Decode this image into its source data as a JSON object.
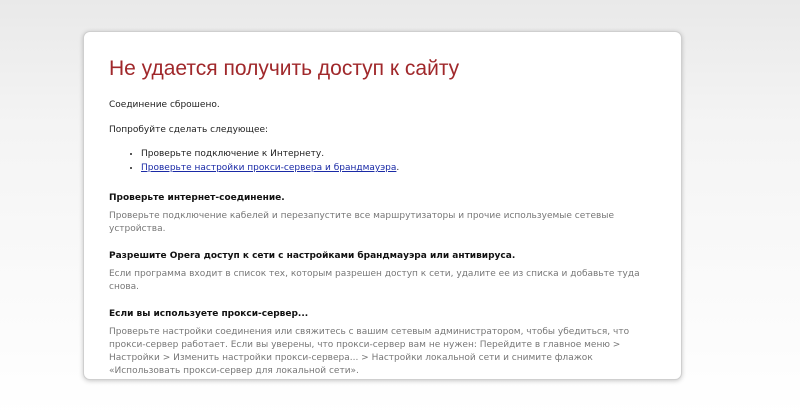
{
  "error": {
    "title": "Не удается получить доступ к сайту",
    "connection_reset": "Соединение сброшено.",
    "try_following": "Попробуйте сделать следующее:",
    "suggestions": [
      {
        "text": "Проверьте подключение к Интернету.",
        "link": false
      },
      {
        "text": "Проверьте настройки прокси-сервера и брандмауэра",
        "link": true,
        "suffix": "."
      }
    ]
  },
  "sections": [
    {
      "title": "Проверьте интернет-соединение.",
      "body": "Проверьте подключение кабелей и перезапустите все маршрутизаторы и прочие используемые сетевые устройства."
    },
    {
      "title": "Разрешите Opera доступ к сети с настройками брандмауэра или антивируса.",
      "body": "Если программа входит в список тех, которым разрешен доступ к сети, удалите ее из списка и добавьте туда снова."
    },
    {
      "title": "Если вы используете прокси-сервер...",
      "body": "Проверьте настройки соединения или свяжитесь с вашим сетевым администратором, чтобы убедиться, что прокси-сервер работает. Если вы уверены, что прокси-сервер вам не нужен: Перейдите в главное меню > Настройки > Изменить настройки прокси-сервера... > Настройки локальной сети и снимите флажок «Использовать прокси-сервер для локальной сети»."
    }
  ],
  "colors": {
    "title": "#a0282b",
    "link": "#1a2aa6",
    "body_text": "#777777"
  }
}
